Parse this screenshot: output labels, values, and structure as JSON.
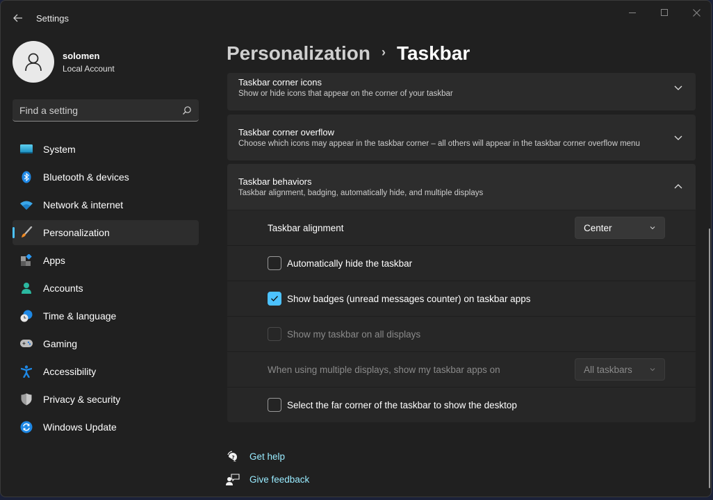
{
  "window": {
    "title": "Settings",
    "controls": {
      "minimize": "minimize",
      "maximize": "maximize",
      "close": "close"
    }
  },
  "profile": {
    "name": "solomen",
    "account_type": "Local Account"
  },
  "search": {
    "placeholder": "Find a setting",
    "value": ""
  },
  "sidebar": {
    "items": [
      {
        "label": "System",
        "icon": "monitor-icon",
        "active": false
      },
      {
        "label": "Bluetooth & devices",
        "icon": "bluetooth-icon",
        "active": false
      },
      {
        "label": "Network & internet",
        "icon": "wifi-icon",
        "active": false
      },
      {
        "label": "Personalization",
        "icon": "brush-icon",
        "active": true
      },
      {
        "label": "Apps",
        "icon": "apps-icon",
        "active": false
      },
      {
        "label": "Accounts",
        "icon": "person-icon",
        "active": false
      },
      {
        "label": "Time & language",
        "icon": "clock-globe-icon",
        "active": false
      },
      {
        "label": "Gaming",
        "icon": "gamepad-icon",
        "active": false
      },
      {
        "label": "Accessibility",
        "icon": "accessibility-icon",
        "active": false
      },
      {
        "label": "Privacy & security",
        "icon": "shield-icon",
        "active": false
      },
      {
        "label": "Windows Update",
        "icon": "update-icon",
        "active": false
      }
    ]
  },
  "breadcrumb": {
    "parent": "Personalization",
    "separator": "›",
    "current": "Taskbar"
  },
  "cards": [
    {
      "title": "Taskbar corner icons",
      "description": "Show or hide icons that appear on the corner of your taskbar",
      "expanded": false
    },
    {
      "title": "Taskbar corner overflow",
      "description": "Choose which icons may appear in the taskbar corner – all others will appear in the taskbar corner overflow menu",
      "expanded": false
    },
    {
      "title": "Taskbar behaviors",
      "description": "Taskbar alignment, badging, automatically hide, and multiple displays",
      "expanded": true
    }
  ],
  "behaviors": {
    "alignment": {
      "label": "Taskbar alignment",
      "value": "Center"
    },
    "auto_hide": {
      "label": "Automatically hide the taskbar",
      "checked": false,
      "enabled": true
    },
    "badges": {
      "label": "Show badges (unread messages counter) on taskbar apps",
      "checked": true,
      "enabled": true
    },
    "all_displays": {
      "label": "Show my taskbar on all displays",
      "checked": false,
      "enabled": false
    },
    "multi_display_apps": {
      "label": "When using multiple displays, show my taskbar apps on",
      "value": "All taskbars",
      "enabled": false
    },
    "far_corner": {
      "label": "Select the far corner of the taskbar to show the desktop",
      "checked": false,
      "enabled": true
    }
  },
  "help": {
    "get_help": "Get help",
    "give_feedback": "Give feedback"
  },
  "colors": {
    "accent": "#4cc2ff",
    "link": "#99ebff",
    "background": "#202020",
    "card": "#2b2b2b"
  }
}
